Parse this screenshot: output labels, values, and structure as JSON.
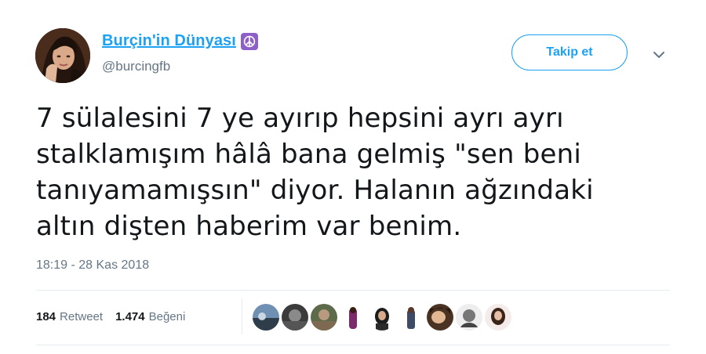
{
  "user": {
    "display_name": "Burçin'in Dünyası",
    "name_emoji": "peace-symbol-icon",
    "handle": "@burcingfb"
  },
  "actions": {
    "follow_label": "Takip et",
    "menu_icon": "chevron-down-icon"
  },
  "tweet": {
    "text": "7 sülalesini 7 ye ayırıp hepsini ayrı ayrı\nstalklamışım hâlâ bana gelmiş \"sen beni\ntanıyamamışsın\" diyor.   Halanın ağzındaki\naltın dişten haberim var benim.",
    "timestamp": "18:19 - 28 Kas 2018"
  },
  "stats": {
    "retweet_count": "184",
    "retweet_label": "Retweet",
    "like_count": "1.474",
    "like_label": "Beğeni"
  },
  "colors": {
    "accent": "#1da1f2",
    "secondary_text": "#657786",
    "primary_text": "#14171a",
    "divider": "#e6ecf0",
    "emoji_bg": "#8c5fc9"
  }
}
